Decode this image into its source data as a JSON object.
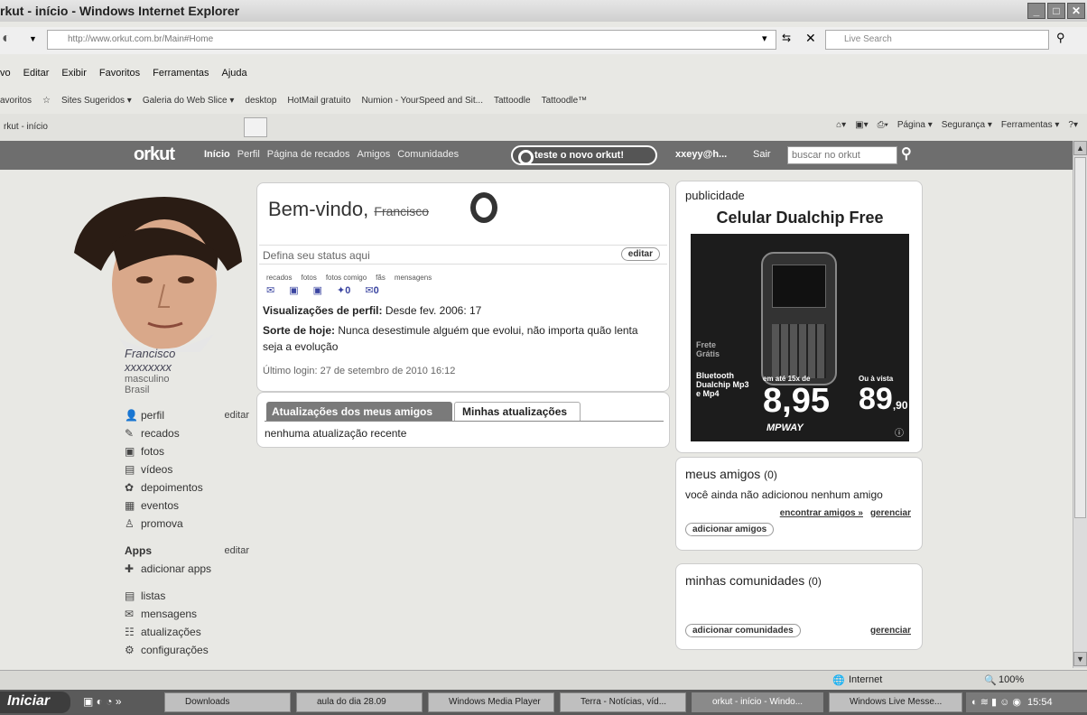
{
  "window": {
    "title": "rkut - início - Windows Internet Explorer",
    "address": "http://www.orkut.com.br/Main#Home",
    "search_placeholder": "Live Search",
    "tab_label": "rkut - início"
  },
  "menu": [
    "vo",
    "Editar",
    "Exibir",
    "Favoritos",
    "Ferramentas",
    "Ajuda"
  ],
  "favorites": {
    "label": "avoritos",
    "items": [
      "Sites Sugeridos ▾",
      "Galeria do Web Slice ▾",
      "desktop",
      "HotMail gratuito",
      "Numion - YourSpeed and Sit...",
      "Tattoodle",
      "Tattoodle™"
    ]
  },
  "toolbar": [
    "Página ▾",
    "Segurança ▾",
    "Ferramentas ▾"
  ],
  "orkut_nav": {
    "logo": "orkut",
    "links": [
      "Início",
      "Perfil",
      "Página de recados",
      "Amigos",
      "Comunidades"
    ],
    "novo_button": "teste o novo orkut!",
    "user": "xxeyy@h...",
    "logout": "Sair",
    "search_placeholder": "buscar no orkut"
  },
  "profile": {
    "name_line1": "Francisco",
    "name_line2": "xxxxxxxx",
    "gender": "masculino",
    "country": "Brasil",
    "edit": "editar",
    "menu": [
      {
        "label": "perfil"
      },
      {
        "label": "recados"
      },
      {
        "label": "fotos"
      },
      {
        "label": "vídeos"
      },
      {
        "label": "depoimentos"
      },
      {
        "label": "eventos"
      },
      {
        "label": "promova"
      }
    ],
    "apps_label": "Apps",
    "apps_edit": "editar",
    "add_apps": "adicionar apps",
    "menu2": [
      {
        "label": "listas"
      },
      {
        "label": "mensagens"
      },
      {
        "label": "atualizações"
      },
      {
        "label": "configurações"
      }
    ]
  },
  "welcome": {
    "greeting": "Bem-vindo, ",
    "name": "Francisco",
    "status_placeholder": "Defina seu status aqui",
    "edit_button": "editar",
    "stats_labels": [
      "recados",
      "fotos",
      "fotos comigo",
      "fãs",
      "mensagens"
    ],
    "stats_values": [
      "",
      "",
      "",
      "0",
      "0"
    ],
    "views_label": "Visualizações de perfil:",
    "views_value": " Desde fev. 2006: 17",
    "luck_label": "Sorte de hoje:",
    "luck_value": " Nunca desestimule alguém que evolui, não importa quão lenta seja a evolução",
    "last_login": "Último login: 27 de setembro de 2010 16:12"
  },
  "updates": {
    "tab_friends": "Atualizações dos meus amigos",
    "tab_mine": "Minhas atualizações",
    "empty": "nenhuma atualização recente"
  },
  "ad": {
    "label": "publicidade",
    "title": "Celular Dualchip Free",
    "frete": "Frete Grátis",
    "features": "Bluetooth Dualchip Mp3 e Mp4",
    "installment_label": "em até 15x de",
    "installment_value": "8,95",
    "cash_label": "Ou à vista",
    "cash_value": "89",
    "cash_cents": ",90",
    "brand": "MPWAY"
  },
  "friends": {
    "title": "meus amigos",
    "count": "(0)",
    "empty": "você ainda não adicionou nenhum amigo",
    "find_link": "encontrar amigos »",
    "manage_link": "gerenciar",
    "add_button": "adicionar amigos"
  },
  "communities": {
    "title": "minhas comunidades",
    "count": "(0)",
    "add_button": "adicionar comunidades",
    "manage_link": "gerenciar"
  },
  "statusbar": {
    "zone": "Internet",
    "zoom": "100%"
  },
  "taskbar": {
    "start": "Iniciar",
    "items": [
      "Downloads",
      "aula do dia 28.09",
      "Windows Media Player",
      "Terra - Notícias, víd...",
      "orkut - início - Windo...",
      "Windows Live Messe..."
    ],
    "clock": "15:54"
  },
  "colors": {
    "nav_bg": "#6e6e6e",
    "tab_active_bg": "#7a7a7a",
    "page_bg": "#e8e8e4"
  }
}
